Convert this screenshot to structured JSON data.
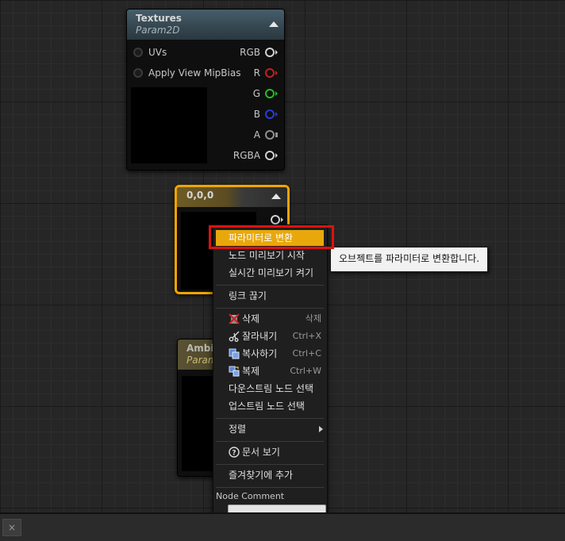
{
  "textures_node": {
    "title": "Textures",
    "subtitle": "Param2D",
    "inputs": [
      "UVs",
      "Apply View MipBias"
    ],
    "outputs": [
      "RGB",
      "R",
      "G",
      "B",
      "A",
      "RGBA"
    ]
  },
  "constant_node": {
    "title": "0,0,0"
  },
  "ambient_node": {
    "title": "Ambie",
    "subtitle": "Param"
  },
  "context_menu": {
    "convert_to_parameter": "파라미터로 변환",
    "start_node_preview": "노드 미리보기 시작",
    "realtime_preview": "실시간 미리보기 켜기",
    "break_links": "링크 끊기",
    "delete": {
      "label": "삭제",
      "shortcut": "삭제"
    },
    "cut": {
      "label": "잘라내기",
      "shortcut": "Ctrl+X"
    },
    "copy": {
      "label": "복사하기",
      "shortcut": "Ctrl+C"
    },
    "duplicate": {
      "label": "복제",
      "shortcut": "Ctrl+W"
    },
    "select_downstream": "다운스트림 노드 선택",
    "select_upstream": "업스트림 노드 선택",
    "alignment": "정렬",
    "view_documentation": "문서 보기",
    "add_to_favorites": "즐겨찾기에 추가",
    "node_comment_label": "Node Comment",
    "node_comment_value": ""
  },
  "tooltip": {
    "text": "오브젝트를 파라미터로 변환합니다."
  },
  "bottom_bar": {
    "close_glyph": "×"
  },
  "colors": {
    "highlight": "#e8a80c",
    "selection_outline": "#f0a500",
    "callout_red": "#e01010",
    "texture_header": "#3b4f5c"
  }
}
